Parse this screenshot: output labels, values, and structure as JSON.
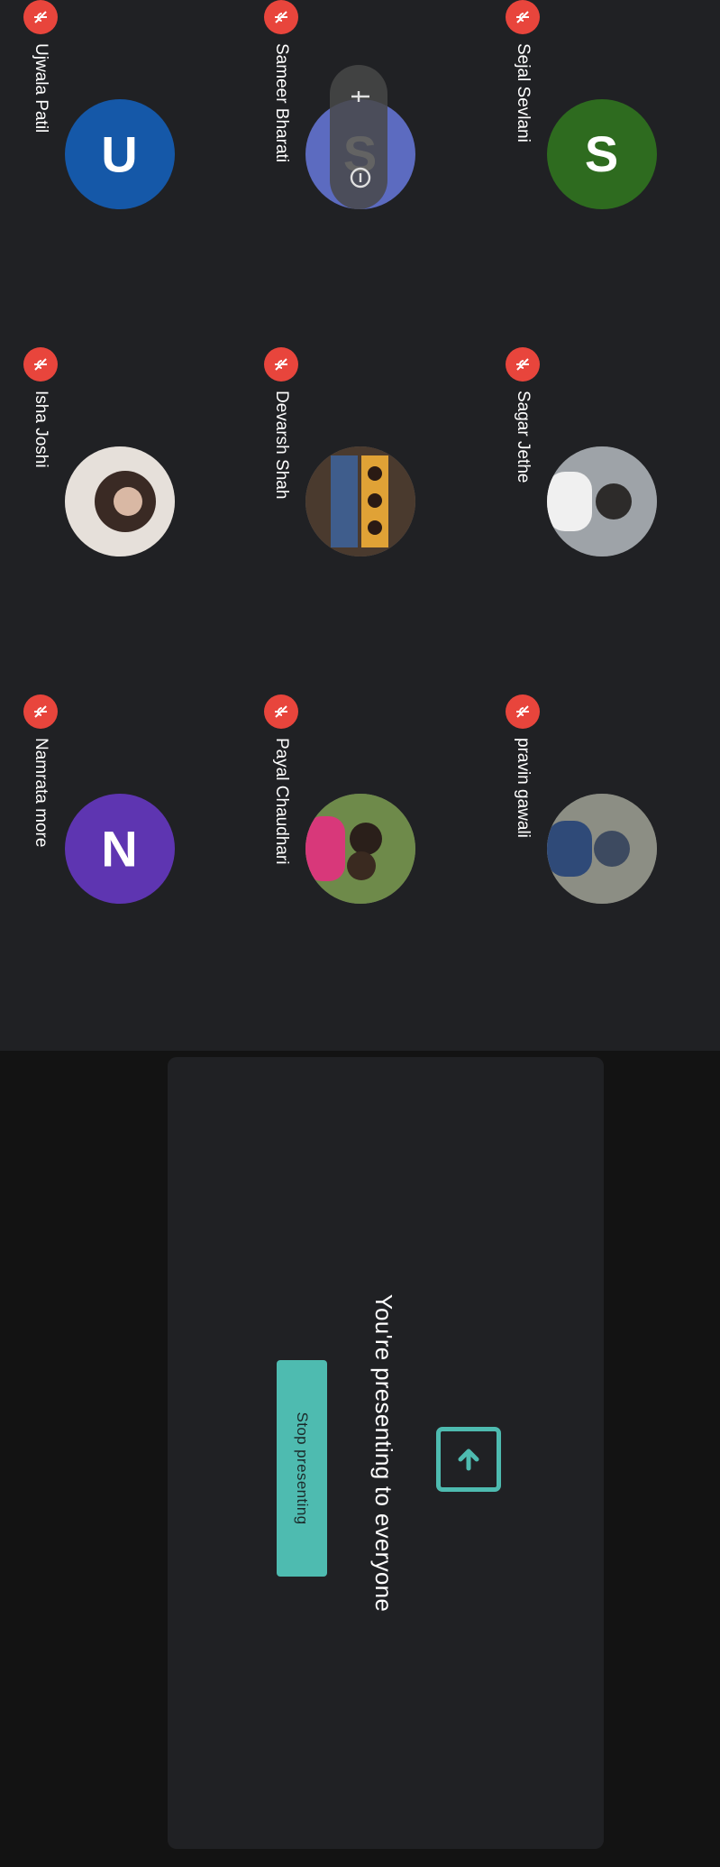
{
  "presenting": {
    "message": "You're presenting to everyone",
    "stop_label": "Stop presenting"
  },
  "participants": [
    {
      "name": "pravin gawali",
      "avatar_type": "photo",
      "muted": true
    },
    {
      "name": "Payal Chaudhari",
      "avatar_type": "photo",
      "muted": true
    },
    {
      "name": "Namrata more",
      "avatar_type": "letter",
      "letter": "N",
      "color": "#5e35b1",
      "muted": true
    },
    {
      "name": "Sagar Jethe",
      "avatar_type": "photo",
      "muted": true
    },
    {
      "name": "Devarsh Shah",
      "avatar_type": "photo",
      "muted": true
    },
    {
      "name": "Isha Joshi",
      "avatar_type": "photo",
      "muted": true
    },
    {
      "name": "Sejal Sevlani",
      "avatar_type": "letter",
      "letter": "S",
      "color": "#2e6b1f",
      "muted": true
    },
    {
      "name": "Sameer Bharati",
      "avatar_type": "letter",
      "letter": "S",
      "color": "#5c6bc0",
      "muted": true
    },
    {
      "name": "Ujwala Patil",
      "avatar_type": "letter",
      "letter": "U",
      "color": "#1558a8",
      "muted": true
    }
  ],
  "colors": {
    "accent": "#4ebbb0",
    "muted_badge": "#e8453c",
    "tile_bg": "#202124"
  },
  "icons": {
    "present": "present-to-all-icon",
    "mic_off": "mic-off-icon",
    "pin": "pin-icon",
    "remove": "remove-icon"
  }
}
